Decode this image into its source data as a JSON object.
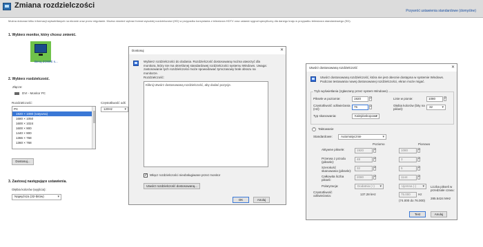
{
  "page": {
    "title": "Zmiana rozdzielczości",
    "restore_link": "Przywróć ustawienia standardowe (domyślne)",
    "intro": "Można dokonać kilku informacji wyświetlanych na ekranie oraz przez migotanie. Można również wybrać format wysokiej rozdzielczości (HD) w przypadku korzystania z telewizora HDTV oraz ustawić sygnał specyficzny dla danego kraju w przypadku telewizora standardowego (SD).",
    "step1": "1. Wybierz monitor, który chcesz zmienić.",
    "monitor_label": "Benq ZOWIE s...",
    "step2": "2. Wybierz rozdzielczość.",
    "connector_label": "Złącze:",
    "connector_value": "DVI - Monitor PC",
    "resolution_label": "Rozdzielczość:",
    "refresh_label": "Częstotliwość odś",
    "refresh_value": "120Hz",
    "resolutions": [
      {
        "label": "PC",
        "group": true,
        "selected": false
      },
      {
        "label": "1920 × 1080 (natywna)",
        "group": false,
        "selected": true
      },
      {
        "label": "1680 × 1050",
        "group": false,
        "selected": false
      },
      {
        "label": "1600 × 1024",
        "group": false,
        "selected": false
      },
      {
        "label": "1600 × 900",
        "group": false,
        "selected": false
      },
      {
        "label": "1440 × 900",
        "group": false,
        "selected": false
      },
      {
        "label": "1366 × 768",
        "group": false,
        "selected": false
      },
      {
        "label": "1360 × 768",
        "group": false,
        "selected": false
      }
    ],
    "customize_button": "Dostosuj...",
    "step3": "3. Zastosuj następujące ustawienia.",
    "color_depth_label": "Głębia kolorów (wyjścia):",
    "color_depth_value": "Najwyższa (32-bitów)"
  },
  "customize_dialog": {
    "title": "Dostosuj",
    "intro": "Wybierz rozdzielczości do dodania. Rozdzielczość dostosowaną można utworzyć dla monitora, który nie ma określonej standardowej rozdzielczości systemu Windows. Uwaga: zastosowanie tych rozdzielczości może spowodować tymczasowy brak obrazu na monitorze.",
    "resolution_label": "Rozdzielczość:",
    "hint": "Kliknij Utwórz dostosowaną rozdzielczość, aby dodać pozycje.",
    "checkbox_label": "Włącz rozdzielczości nieobsługiwane przez monitor",
    "create_button": "Utwórz rozdzielczość dostosowaną...",
    "ok_button": "OK",
    "cancel_button": "Anuluj"
  },
  "custom_res_dialog": {
    "title": "Utwórz dostosowaną rozdzielczość",
    "intro": "Utwórz dostosowaną rozdzielczość, która nie jest obecnie dostępna w systemie Windows. Podczas testowania nowej dostosowanej rozdzielczości, ekran może migać.",
    "display_mode_legend": "Tryb wyświetlania (zgłaszany przez system Windows)",
    "h_pixels_label": "Piksele w poziomie:",
    "h_pixels_value": "1920",
    "v_lines_label": "Linie w pionie:",
    "v_lines_value": "1080",
    "refresh_label": "Częstotliwość odświeżania (Hz):",
    "refresh_value": "75",
    "color_depth_label": "Głębia kolorów (bity na piksel):",
    "color_depth_value": "32",
    "scan_type_label": "Typ skanowania:",
    "scan_type_value": "Kalejdoskopowe",
    "timing_legend": "Taktowanie",
    "standards_label": "Standardowe:",
    "standards_value": "Automatycznie",
    "col_horizontal": "Poziomo",
    "col_vertical": "Pionowo",
    "timing_rows": [
      {
        "label": "Aktywne piksele:",
        "h": "1920",
        "v": "1080"
      },
      {
        "label": "Przerwa z przodu (piksele):",
        "h": "48",
        "v": "3"
      },
      {
        "label": "Szerokość skanowania (piksele):",
        "h": "32",
        "v": "5"
      },
      {
        "label": "Całkowita liczba pikseli:",
        "h": "2080",
        "v": "1144"
      }
    ],
    "polarity_label": "Polaryzacja:",
    "polarity_h": "Dodatnia (+)",
    "polarity_v": "Ujemna (-)",
    "refresh_rate_label": "Częstotliwość odświeżania:",
    "refresh_h": "137.28 kHz",
    "refresh_v": "75.000",
    "refresh_unit": "Hz",
    "refresh_v2": "(74.000 do 76.000)",
    "pixel_clock_label": "Liczba pikseli w przedziale czasu:",
    "pixel_clock_value": "285.5424 MHz",
    "test_button": "Test",
    "cancel_button": "Anuluj"
  }
}
